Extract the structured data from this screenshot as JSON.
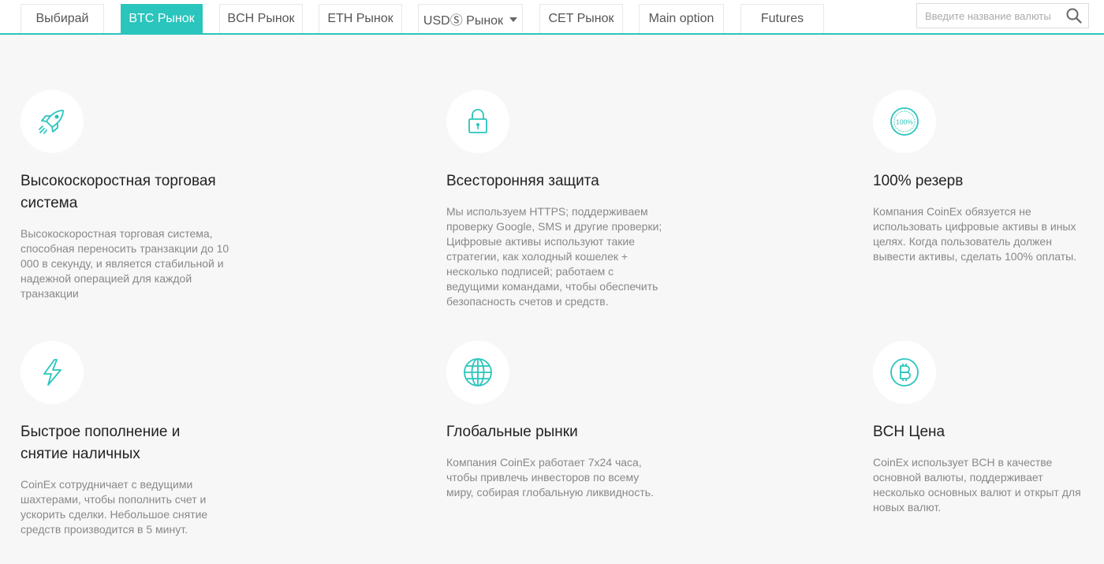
{
  "tabs": [
    {
      "label": "Выбирай",
      "active": false
    },
    {
      "label": "BTC Рынок",
      "active": true
    },
    {
      "label": "BCH Рынок",
      "active": false
    },
    {
      "label": "ETH Рынок",
      "active": false
    },
    {
      "label": "USDⓈ Рынок",
      "active": false,
      "dropdown": true
    },
    {
      "label": "CET Рынок",
      "active": false
    },
    {
      "label": "Main option",
      "active": false
    },
    {
      "label": "Futures",
      "active": false
    }
  ],
  "search": {
    "placeholder": "Введите название валюты",
    "value": "",
    "icon": "search-icon"
  },
  "colors": {
    "accent": "#2ac5bc",
    "background": "#f7f7f7"
  },
  "features": [
    {
      "icon": "rocket-icon",
      "title": "Высокоскоростная торговая система",
      "description": "Высокоскоростная торговая система, способная переносить транзакции до 10 000 в секунду, и является стабильной и надежной операцией для каждой транзакции"
    },
    {
      "icon": "padlock-icon",
      "title": "Всесторонняя защита",
      "description": "Мы используем HTTPS; поддерживаем проверку Google, SMS и другие проверки; Цифровые активы используют такие стратегии, как холодный кошелек + несколько подписей; работаем с ведущими командами, чтобы обеспечить безопасность счетов и средств."
    },
    {
      "icon": "reserve-100-icon",
      "icon_text": "100%",
      "title": "100% резерв",
      "description": "Компания CoinEx обязуется не использовать цифровые активы в иных целях. Когда пользователь должен вывести активы, сделать 100% оплаты."
    },
    {
      "icon": "lightning-icon",
      "title": "Быстрое пополнение и снятие наличных",
      "description": "CoinEx сотрудничает с ведущими шахтерами, чтобы пополнить счет и ускорить сделки. Небольшое снятие средств производится в 5 минут."
    },
    {
      "icon": "globe-icon",
      "title": "Глобальные рынки",
      "description": "Компания CoinEx работает 7x24 часа, чтобы привлечь инвесторов по всему миру, собирая глобальную ликвидность."
    },
    {
      "icon": "bitcoin-coin-icon",
      "title": "BCH Цена",
      "description": "CoinEx использует BCH в качестве основной валюты, поддерживает несколько основных валют и открыт для новых валют."
    }
  ]
}
